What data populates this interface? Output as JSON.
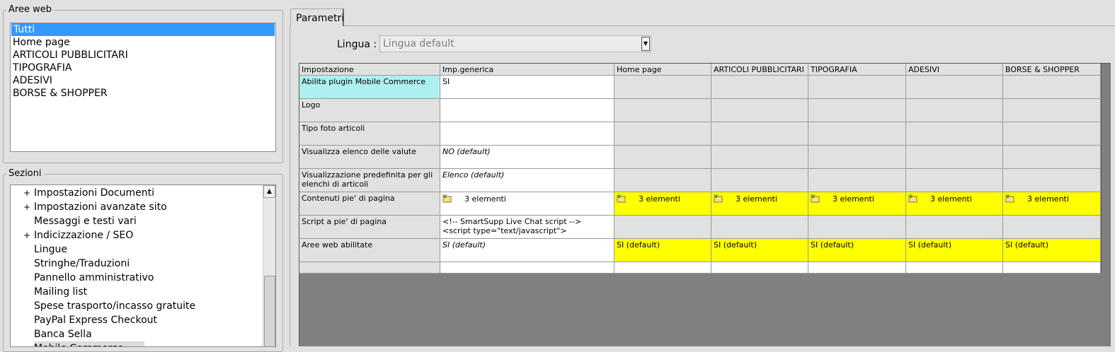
{
  "aree_web": {
    "legend": "Aree web",
    "items": [
      "Tutti",
      "Home page",
      "ARTICOLI PUBBLICITARI",
      "TIPOGRAFIA",
      "ADESIVI",
      "BORSE & SHOPPER"
    ],
    "selected": "Tutti"
  },
  "sezioni": {
    "legend": "Sezioni",
    "items": [
      {
        "label": "Impostazioni Documenti",
        "expander": "+"
      },
      {
        "label": "Impostazioni avanzate sito",
        "expander": "+"
      },
      {
        "label": "Messaggi e testi vari",
        "expander": ""
      },
      {
        "label": "Indicizzazione / SEO",
        "expander": "+"
      },
      {
        "label": "Lingue",
        "expander": ""
      },
      {
        "label": "Stringhe/Traduzioni",
        "expander": ""
      },
      {
        "label": "Pannello amministrativo",
        "expander": ""
      },
      {
        "label": "Mailing list",
        "expander": ""
      },
      {
        "label": "Spese trasporto/incasso gratuite",
        "expander": ""
      },
      {
        "label": "PayPal Express Checkout",
        "expander": ""
      },
      {
        "label": "Banca Sella",
        "expander": ""
      },
      {
        "label": "Mobile Commerce",
        "expander": ""
      }
    ]
  },
  "tab": {
    "label": "Parametri"
  },
  "lingua": {
    "label": "Lingua :",
    "value": "Lingua default"
  },
  "grid": {
    "columns": [
      "Impostazione",
      "Imp.generica",
      "Home page",
      "ARTICOLI PUBBLICITARI",
      "TIPOGRAFIA",
      "ADESIVI",
      "BORSE & SHOPPER"
    ],
    "rows": [
      {
        "label": "Abilita plugin Mobile Commerce",
        "generic": "SI",
        "generic_style": "plain",
        "areas": [
          "",
          "",
          "",
          "",
          ""
        ],
        "areas_yellow": false,
        "highlight": true
      },
      {
        "label": "Logo",
        "generic": "",
        "generic_style": "plain",
        "areas": [
          "",
          "",
          "",
          "",
          ""
        ],
        "areas_yellow": false
      },
      {
        "label": "Tipo foto articoli",
        "generic": "",
        "generic_style": "plain",
        "areas": [
          "",
          "",
          "",
          "",
          ""
        ],
        "areas_yellow": false
      },
      {
        "label": "Visualizza elenco delle valute",
        "generic": "NO (default)",
        "generic_style": "italic",
        "areas": [
          "",
          "",
          "",
          "",
          ""
        ],
        "areas_yellow": false
      },
      {
        "label": "Visualizzazione predefinita per gli elenchi di articoli",
        "generic": "Elenco (default)",
        "generic_style": "italic",
        "areas": [
          "",
          "",
          "",
          "",
          ""
        ],
        "areas_yellow": false
      },
      {
        "label": "Contenuti pie' di pagina",
        "generic": "3 elementi",
        "generic_style": "folder",
        "areas": [
          "3 elementi",
          "3 elementi",
          "3 elementi",
          "3 elementi",
          "3 elementi"
        ],
        "areas_yellow": true,
        "folder": true
      },
      {
        "label": "Script a pie' di pagina",
        "generic": "<!-- SmartSupp Live Chat script -->\n<script type=\"text/javascript\">",
        "generic_style": "plain",
        "areas": [
          "",
          "",
          "",
          "",
          ""
        ],
        "areas_yellow": false
      },
      {
        "label": "Aree web abilitate",
        "generic": "SI (default)",
        "generic_style": "italic",
        "areas": [
          "SI (default)",
          "SI (default)",
          "SI (default)",
          "SI (default)",
          "SI (default)"
        ],
        "areas_yellow": true
      }
    ]
  },
  "colors": {
    "selection": "#3399ff",
    "highlight_cell": "#aef0f0",
    "yellow_cell": "#ffff00",
    "grid_background": "#808080"
  }
}
